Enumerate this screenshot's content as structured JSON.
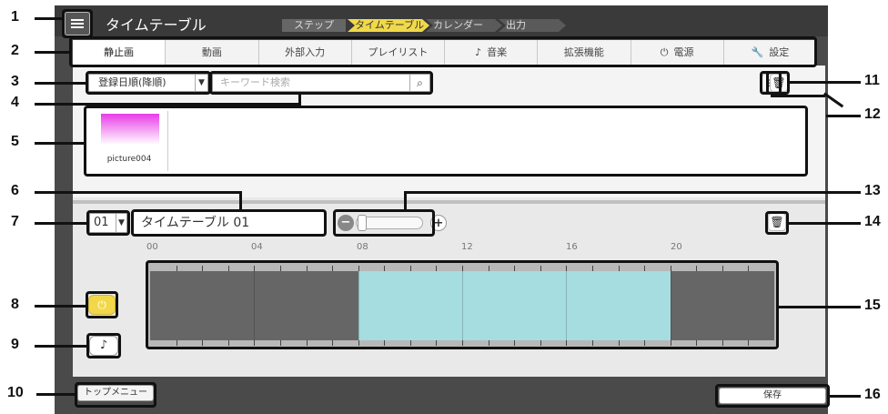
{
  "header": {
    "title": "タイムテーブル",
    "menu_icon": "hamburger-menu-icon"
  },
  "steps": {
    "label": "ステップ",
    "items": [
      "タイムテーブル",
      "カレンダー",
      "出力"
    ],
    "active_index": 0
  },
  "tabs": [
    {
      "label": "静止画",
      "icon": ""
    },
    {
      "label": "動画",
      "icon": ""
    },
    {
      "label": "外部入力",
      "icon": ""
    },
    {
      "label": "プレイリスト",
      "icon": ""
    },
    {
      "label": "音楽",
      "icon": "♪"
    },
    {
      "label": "拡張機能",
      "icon": ""
    },
    {
      "label": "電源",
      "icon": "⏻"
    },
    {
      "label": "設定",
      "icon": "🔧"
    }
  ],
  "active_tab": 0,
  "toolbar": {
    "sort_value": "登録日順(降順)",
    "search_placeholder": "キーワード検索"
  },
  "gallery": {
    "items": [
      {
        "label": "picture004"
      }
    ]
  },
  "timetable": {
    "number": "01",
    "name": "タイムテーブル 01",
    "hours": [
      "00",
      "04",
      "08",
      "12",
      "16",
      "20"
    ],
    "active_from_hour": 8,
    "active_to_hour": 20
  },
  "footer": {
    "top_menu_label": "トップメニュー",
    "save_label": "保存"
  },
  "callouts": [
    "1",
    "2",
    "3",
    "4",
    "5",
    "6",
    "7",
    "8",
    "9",
    "10",
    "11",
    "12",
    "13",
    "14",
    "15",
    "16"
  ],
  "colors": {
    "active_step": "#f0d94a",
    "timeline_on": "#a5dde0",
    "timeline_off": "#666666",
    "power_button": "#f2d849"
  }
}
